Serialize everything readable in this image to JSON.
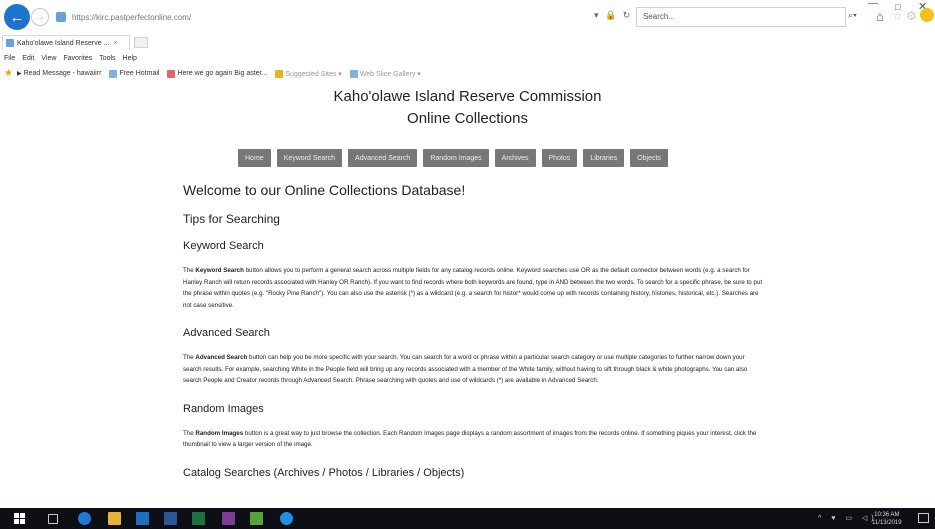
{
  "browser": {
    "url": "https://kirc.pastperfectonline.com/",
    "search_placeholder": "Search...",
    "tab_title": "Kaho'olawe Island Reserve ...",
    "menu": [
      "File",
      "Edit",
      "View",
      "Favorites",
      "Tools",
      "Help"
    ],
    "favorites": [
      "Read Message - hawaiirr",
      "Free Hotmail",
      "Here we go again Big aster...",
      "Suggested Sites ▾",
      "Web Slice Gallery ▾"
    ],
    "accent_color": "#1e73d0"
  },
  "page": {
    "title": "Kaho'olawe Island Reserve Commission",
    "subtitle": "Online Collections",
    "nav": [
      "Home",
      "Keyword Search",
      "Advanced Search",
      "Random Images",
      "Archives",
      "Photos",
      "Libraries",
      "Objects"
    ],
    "welcome": "Welcome to our Online Collections Database!",
    "tips_heading": "Tips for Searching",
    "sections": [
      {
        "heading": "Keyword Search",
        "intro": "The ",
        "bold": "Keyword Search",
        "body": " button allows you to perform a general search across multiple fields for any catalog records online. Keyword searches use OR as the default connector between words (e.g. a search for Hanley Ranch will return records associated with Hanley OR Ranch). If you want to find records where both keywords are found, type in AND between the two words. To search for a specific phrase, be sure to put the phrase within quotes (e.g. \"Rocky Pine Ranch\"). You can also use the asterisk (*) as a wildcard (e.g. a search for histor* would come up with records containing history, histories, historical, etc.). Searches are not case sensitive."
      },
      {
        "heading": "Advanced Search",
        "intro": "The ",
        "bold": "Advanced Search",
        "body": " button can help you be more specific with your search. You can search for a word or phrase within a particular search category or use multiple categories to further narrow down your search results. For example, searching White in the People field will bring up any records associated with a member of the White family, without having to sift through black & white photographs. You can also search People and Creator records through Advanced Search. Phrase searching with quotes and use of wildcards (*) are available in Advanced Search."
      },
      {
        "heading": "Random Images",
        "intro": "The ",
        "bold": "Random Images",
        "body": " button is a great way to just browse the collection. Each Random Images page displays a random assortment of images from the records online. If something piques your interest, click the thumbnail to view a larger version of the image."
      }
    ],
    "last_heading": "Catalog Searches (Archives / Photos / Libraries / Objects)"
  },
  "taskbar": {
    "time": "10:36 AM",
    "date": "11/13/2019"
  }
}
